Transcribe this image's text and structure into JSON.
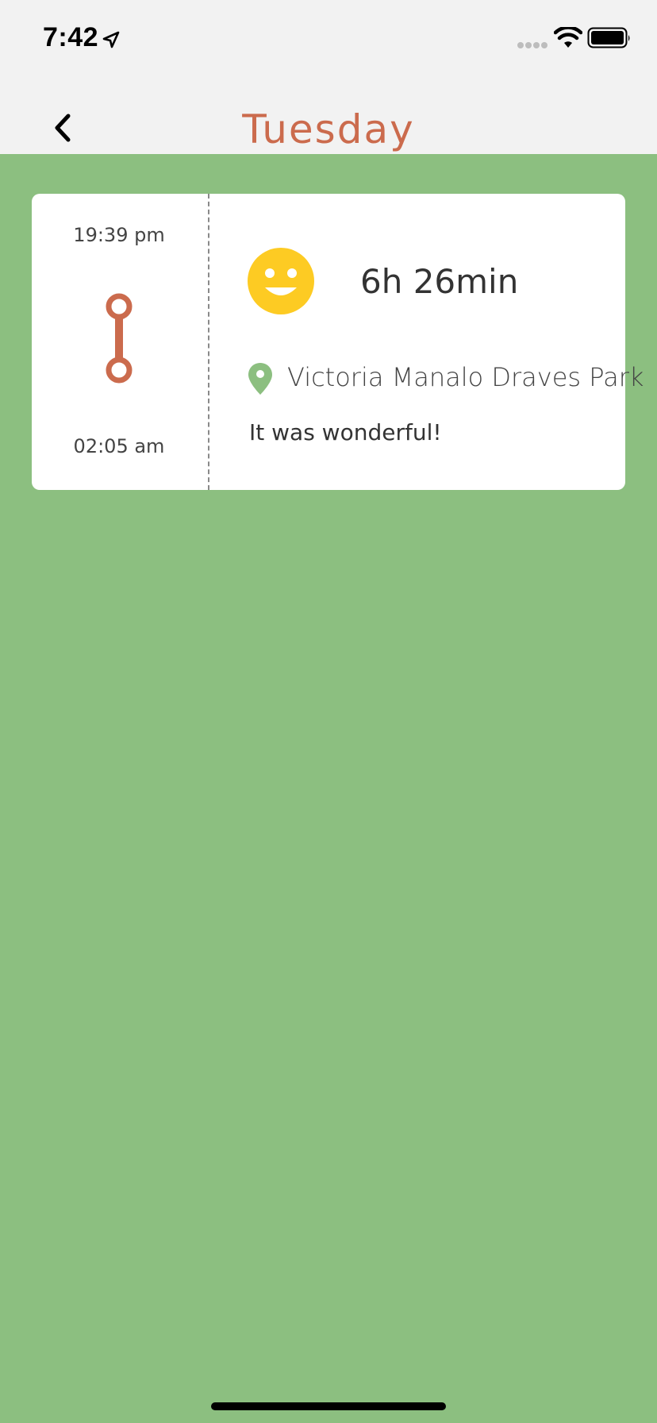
{
  "status_bar": {
    "time": "7:42",
    "icons": [
      "location-arrow-icon",
      "cellular-signal-icon",
      "wifi-icon",
      "battery-icon"
    ]
  },
  "header": {
    "title": "Tuesday",
    "back_icon": "chevron-left-icon"
  },
  "entry": {
    "start_time": "19:39 pm",
    "end_time": "02:05 am",
    "mood_icon": "smiley-face-icon",
    "duration": "6h 26min",
    "location_icon": "map-pin-icon",
    "location": "Victoria Manalo Draves Park",
    "note": "It was wonderful!"
  },
  "colors": {
    "background": "#8cbf80",
    "header_background": "#f2f2f2",
    "title": "#cb6b4d",
    "timeline": "#cb6b4d",
    "mood": "#fdcb23",
    "pin": "#8cbf80"
  }
}
